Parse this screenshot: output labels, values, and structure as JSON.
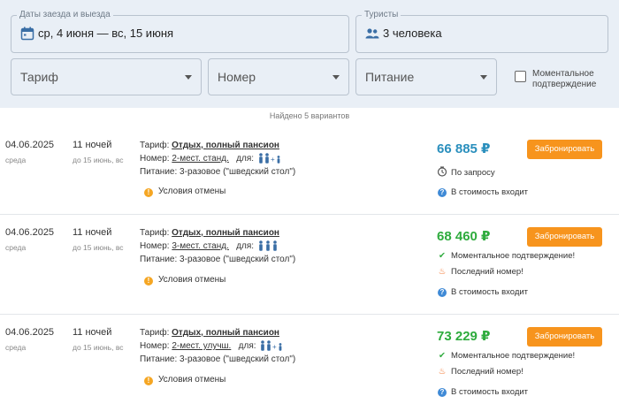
{
  "filters": {
    "dates": {
      "legend": "Даты заезда и выезда",
      "value": "ср, 4 июня — вс, 15 июня",
      "icon": "calendar-icon"
    },
    "tourists": {
      "legend": "Туристы",
      "value": "3 человека",
      "icon": "people-icon"
    },
    "tariff": {
      "label": "Тариф"
    },
    "room": {
      "label": "Номер"
    },
    "meals": {
      "label": "Питание"
    },
    "instant_confirmation": {
      "label_line1": "Моментальное",
      "label_line2": "подтверждение",
      "checked": false
    }
  },
  "found_text": "Найдено 5 вариантов",
  "labels": {
    "tariff_prefix": "Тариф:",
    "room_prefix": "Номер:",
    "for_prefix": "для:",
    "meals_prefix": "Питание:",
    "cancel_terms": "Условия отмены",
    "book_button": "Забронировать",
    "included": "В стоимость входит"
  },
  "offers": [
    {
      "date": "04.06.2025",
      "weekday": "среда",
      "nights": "11 ночей",
      "until": "до 15 июнь, вс",
      "tariff": "Отдых, полный пансион",
      "room": "2-мест. станд.",
      "meals": "3-разовое (\"шведский стол\")",
      "price": "66 885 ₽",
      "price_color": "#2a8fbd",
      "features": [
        "По запросу"
      ]
    },
    {
      "date": "04.06.2025",
      "weekday": "среда",
      "nights": "11 ночей",
      "until": "до 15 июнь, вс",
      "tariff": "Отдых, полный пансион",
      "room": "3-мест. станд.",
      "meals": "3-разовое (\"шведский стол\")",
      "price": "68 460 ₽",
      "price_color": "#2eab3d",
      "features": [
        "Моментальное подтверждение!",
        "Последний номер!"
      ]
    },
    {
      "date": "04.06.2025",
      "weekday": "среда",
      "nights": "11 ночей",
      "until": "до 15 июнь, вс",
      "tariff": "Отдых, полный пансион",
      "room": "2-мест. улучш.",
      "meals": "3-разовое (\"шведский стол\")",
      "price": "73 229 ₽",
      "price_color": "#2eab3d",
      "features": [
        "Моментальное подтверждение!",
        "Последний номер!"
      ]
    }
  ],
  "colors": {
    "accent_orange": "#f7941d",
    "border": "#b9c3cf",
    "filter_bg": "#e9eff6",
    "info_blue": "#3f8ad6"
  }
}
